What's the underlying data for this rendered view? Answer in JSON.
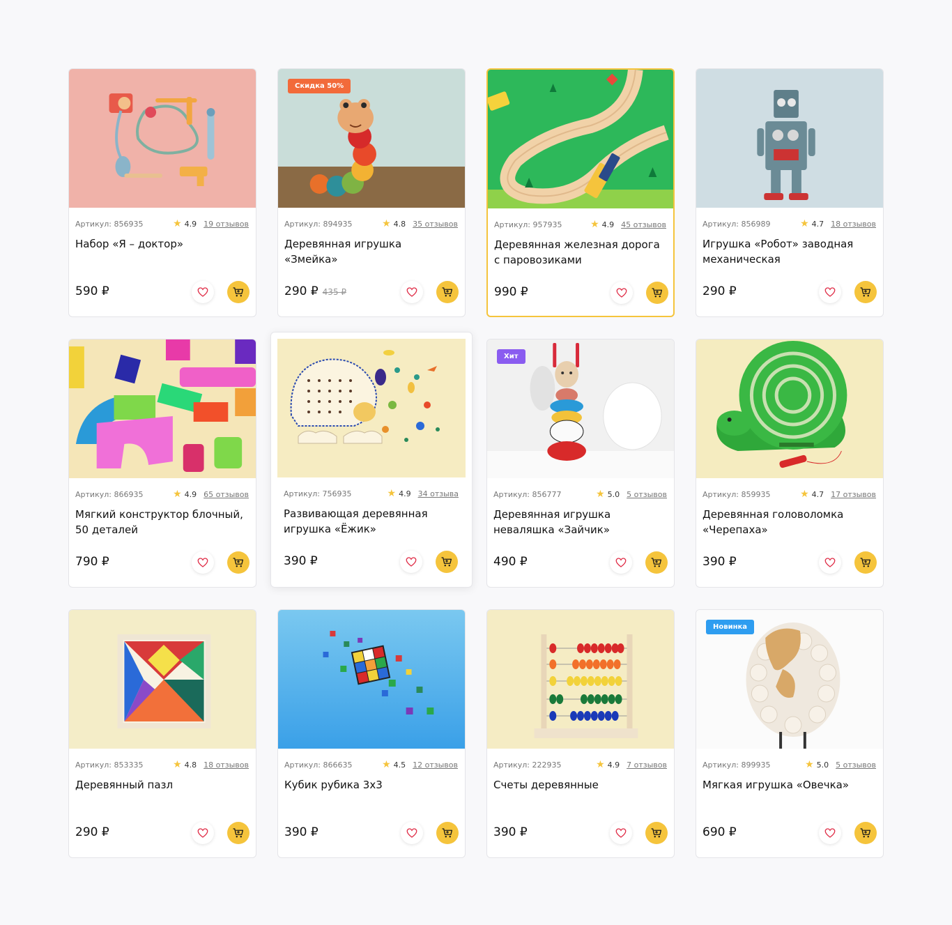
{
  "products": [
    {
      "sku": "Артикул: 856935",
      "rating": "4.9",
      "reviews": "19 отзывов",
      "title": "Набор «Я – доктор»",
      "price": "590 ₽",
      "old_price": "",
      "badge": ""
    },
    {
      "sku": "Артикул: 894935",
      "rating": "4.8",
      "reviews": "35 отзывов",
      "title": "Деревянная игрушка «Змейка»",
      "price": "290 ₽",
      "old_price": "435 ₽",
      "badge": "Скидка 50%"
    },
    {
      "sku": "Артикул: 957935",
      "rating": "4.9",
      "reviews": "45 отзывов",
      "title": "Деревянная железная дорога с паровозиками",
      "price": "990 ₽",
      "old_price": "",
      "badge": ""
    },
    {
      "sku": "Артикул: 856989",
      "rating": "4.7",
      "reviews": "18 отзывов",
      "title": "Игрушка «Робот» заводная механическая",
      "price": "290 ₽",
      "old_price": "",
      "badge": ""
    },
    {
      "sku": "Артикул: 866935",
      "rating": "4.9",
      "reviews": "65 отзывов",
      "title": "Мягкий конструктор блочный, 50 деталей",
      "price": "790 ₽",
      "old_price": "",
      "badge": ""
    },
    {
      "sku": "Артикул: 756935",
      "rating": "4.9",
      "reviews": "34 отзыва",
      "title": "Развивающая деревянная игрушка «Ёжик»",
      "price": "390 ₽",
      "old_price": "",
      "badge": ""
    },
    {
      "sku": "Артикул: 856777",
      "rating": "5.0",
      "reviews": "5 отзывов",
      "title": "Деревянная игрушка неваляшка «Зайчик»",
      "price": "490 ₽",
      "old_price": "",
      "badge": "Хит"
    },
    {
      "sku": "Артикул: 859935",
      "rating": "4.7",
      "reviews": "17 отзывов",
      "title": "Деревянная головоломка «Черепаха»",
      "price": "390 ₽",
      "old_price": "",
      "badge": ""
    },
    {
      "sku": "Артикул: 853335",
      "rating": "4.8",
      "reviews": "18 отзывов",
      "title": "Деревянный пазл",
      "price": "290 ₽",
      "old_price": "",
      "badge": ""
    },
    {
      "sku": "Артикул: 866635",
      "rating": "4.5",
      "reviews": "12 отзывов",
      "title": "Кубик рубика 3x3",
      "price": "390 ₽",
      "old_price": "",
      "badge": ""
    },
    {
      "sku": "Артикул: 222935",
      "rating": "4.9",
      "reviews": "7 отзывов",
      "title": "Счеты деревянные",
      "price": "390 ₽",
      "old_price": "",
      "badge": ""
    },
    {
      "sku": "Артикул: 899935",
      "rating": "5.0",
      "reviews": "5 отзывов",
      "title": "Мягкая игрушка «Овечка»",
      "price": "690 ₽",
      "old_price": "",
      "badge": "Новинка"
    }
  ],
  "colors": {
    "accent": "#f5c43c",
    "badge_sale": "#f26a3a",
    "badge_hit": "#8a5cf0",
    "badge_new": "#2e9df0",
    "heart": "#e0304a"
  },
  "icons": {
    "rating": "star-icon",
    "favorite": "heart-icon",
    "cart": "cart-icon"
  }
}
